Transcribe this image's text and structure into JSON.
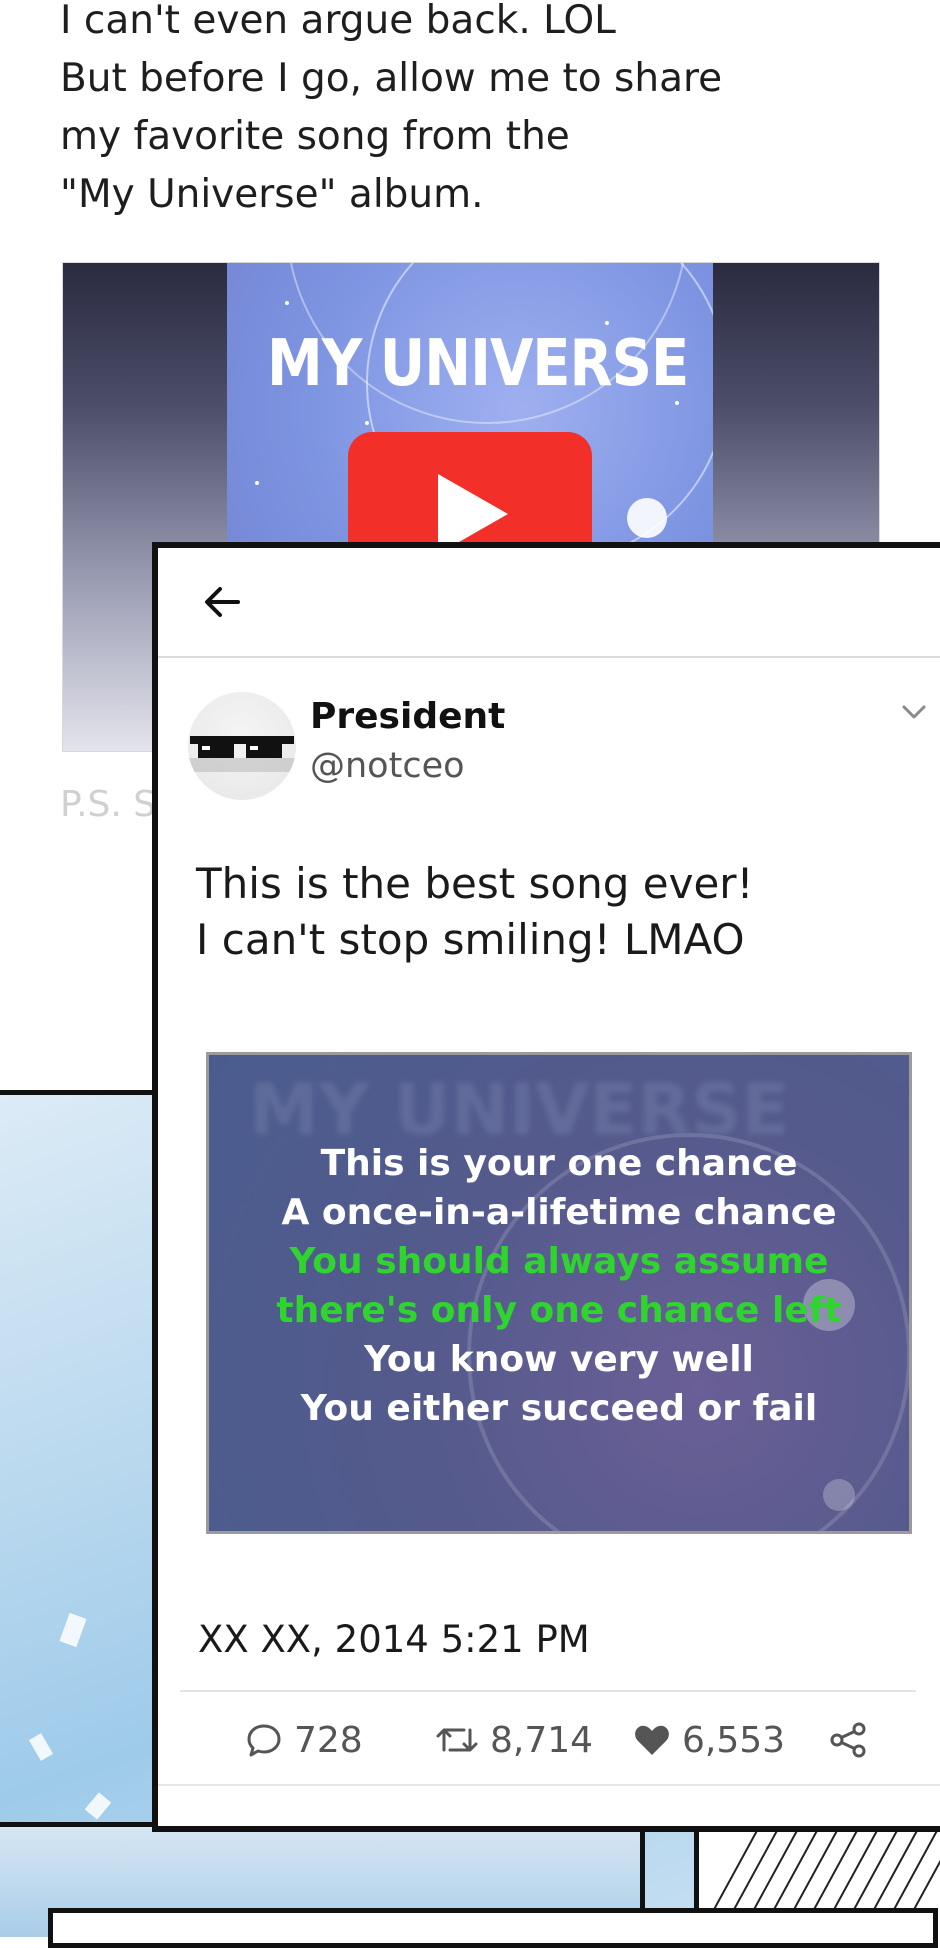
{
  "intro": {
    "text": "I can't even argue back. LOL\nBut before I go, allow me to share\nmy favorite song from the\n\"My Universe\" album."
  },
  "video": {
    "cover_title": "MY UNIVERSE"
  },
  "ps_text": "P.S. S",
  "tweet": {
    "author_name": "President",
    "author_handle": "@notceo",
    "body": "This is the best song ever!\nI can't stop smiling! LMAO",
    "image_title": "MY UNIVERSE",
    "lyrics": [
      {
        "text": "This is your one chance",
        "highlight": false
      },
      {
        "text": "A once-in-a-lifetime chance",
        "highlight": false
      },
      {
        "text": "You should always assume",
        "highlight": true
      },
      {
        "text": "there's only one chance left",
        "highlight": true
      },
      {
        "text": "You know very well",
        "highlight": false
      },
      {
        "text": "You either succeed or fail",
        "highlight": false
      }
    ],
    "timestamp": "XX XX, 2014 5:21 PM",
    "replies": "728",
    "retweets": "8,714",
    "likes": "6,553"
  },
  "colors": {
    "lyric_highlight": "#2fd42f",
    "play_button": "#f22f28"
  },
  "icons": [
    "back-arrow-icon",
    "chevron-down-icon",
    "reply-icon",
    "retweet-icon",
    "heart-icon",
    "share-icon",
    "play-icon",
    "sunglasses-icon"
  ]
}
